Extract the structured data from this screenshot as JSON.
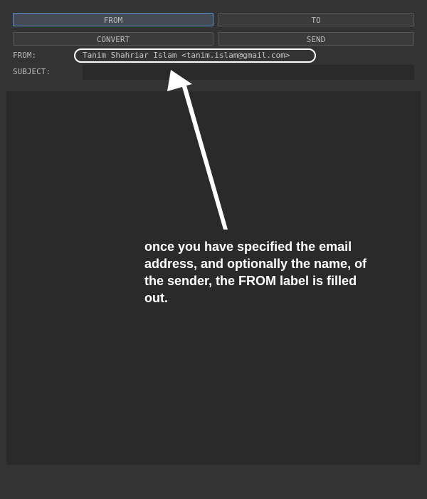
{
  "buttons": {
    "from": "FROM",
    "to": "TO",
    "convert": "CONVERT",
    "send": "SEND"
  },
  "fields": {
    "from_label": "FROM:",
    "from_value": "Tanim Shahriar Islam <tanim.islam@gmail.com>",
    "subject_label": "SUBJECT:",
    "subject_value": ""
  },
  "annotation": {
    "text": "once you have specified the email address, and optionally the name, of the sender, the FROM label is filled out."
  },
  "colors": {
    "active_border": "#5a8fd0",
    "annotation": "#ffffff"
  }
}
